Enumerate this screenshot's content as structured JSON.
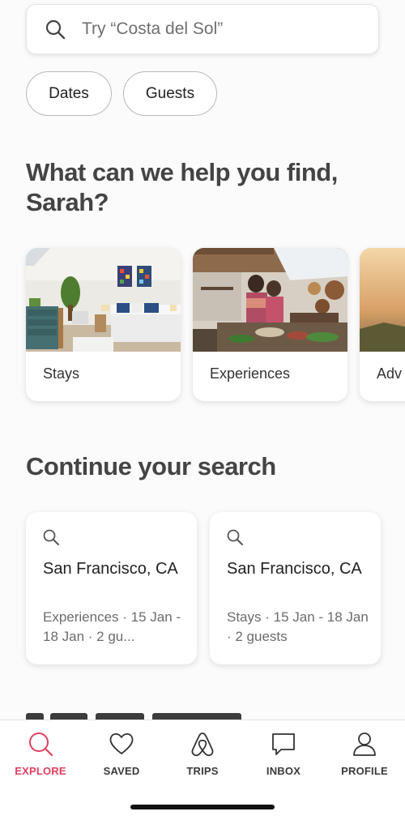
{
  "search": {
    "placeholder": "Try “Costa del Sol”",
    "icon": "search-icon"
  },
  "filters": {
    "dates_label": "Dates",
    "guests_label": "Guests"
  },
  "greeting": "What can we help you find, Sarah?",
  "categories": [
    {
      "label": "Stays",
      "image": "bedroom-photo"
    },
    {
      "label": "Experiences",
      "image": "cooking-photo"
    },
    {
      "label": "Adv",
      "image": "landscape-photo"
    }
  ],
  "continue_search": {
    "title": "Continue your search",
    "items": [
      {
        "place": "San Francisco, CA",
        "details": "Experiences · 15 Jan - 18 Jan · 2 gu..."
      },
      {
        "place": "San Francisco, CA",
        "details": "Stays · 15 Jan - 18 Jan · 2 guests"
      }
    ]
  },
  "tabbar": {
    "items": [
      {
        "label": "EXPLORE",
        "icon": "search-icon",
        "active": true
      },
      {
        "label": "SAVED",
        "icon": "heart-icon",
        "active": false
      },
      {
        "label": "TRIPS",
        "icon": "airbnb-logo-icon",
        "active": false
      },
      {
        "label": "INBOX",
        "icon": "chat-bubble-icon",
        "active": false
      },
      {
        "label": "PROFILE",
        "icon": "person-icon",
        "active": false
      }
    ]
  },
  "colors": {
    "accent": "#e0405f",
    "text_primary": "#222222",
    "text_secondary": "#6c6c6c",
    "background": "#fcfbfc"
  }
}
